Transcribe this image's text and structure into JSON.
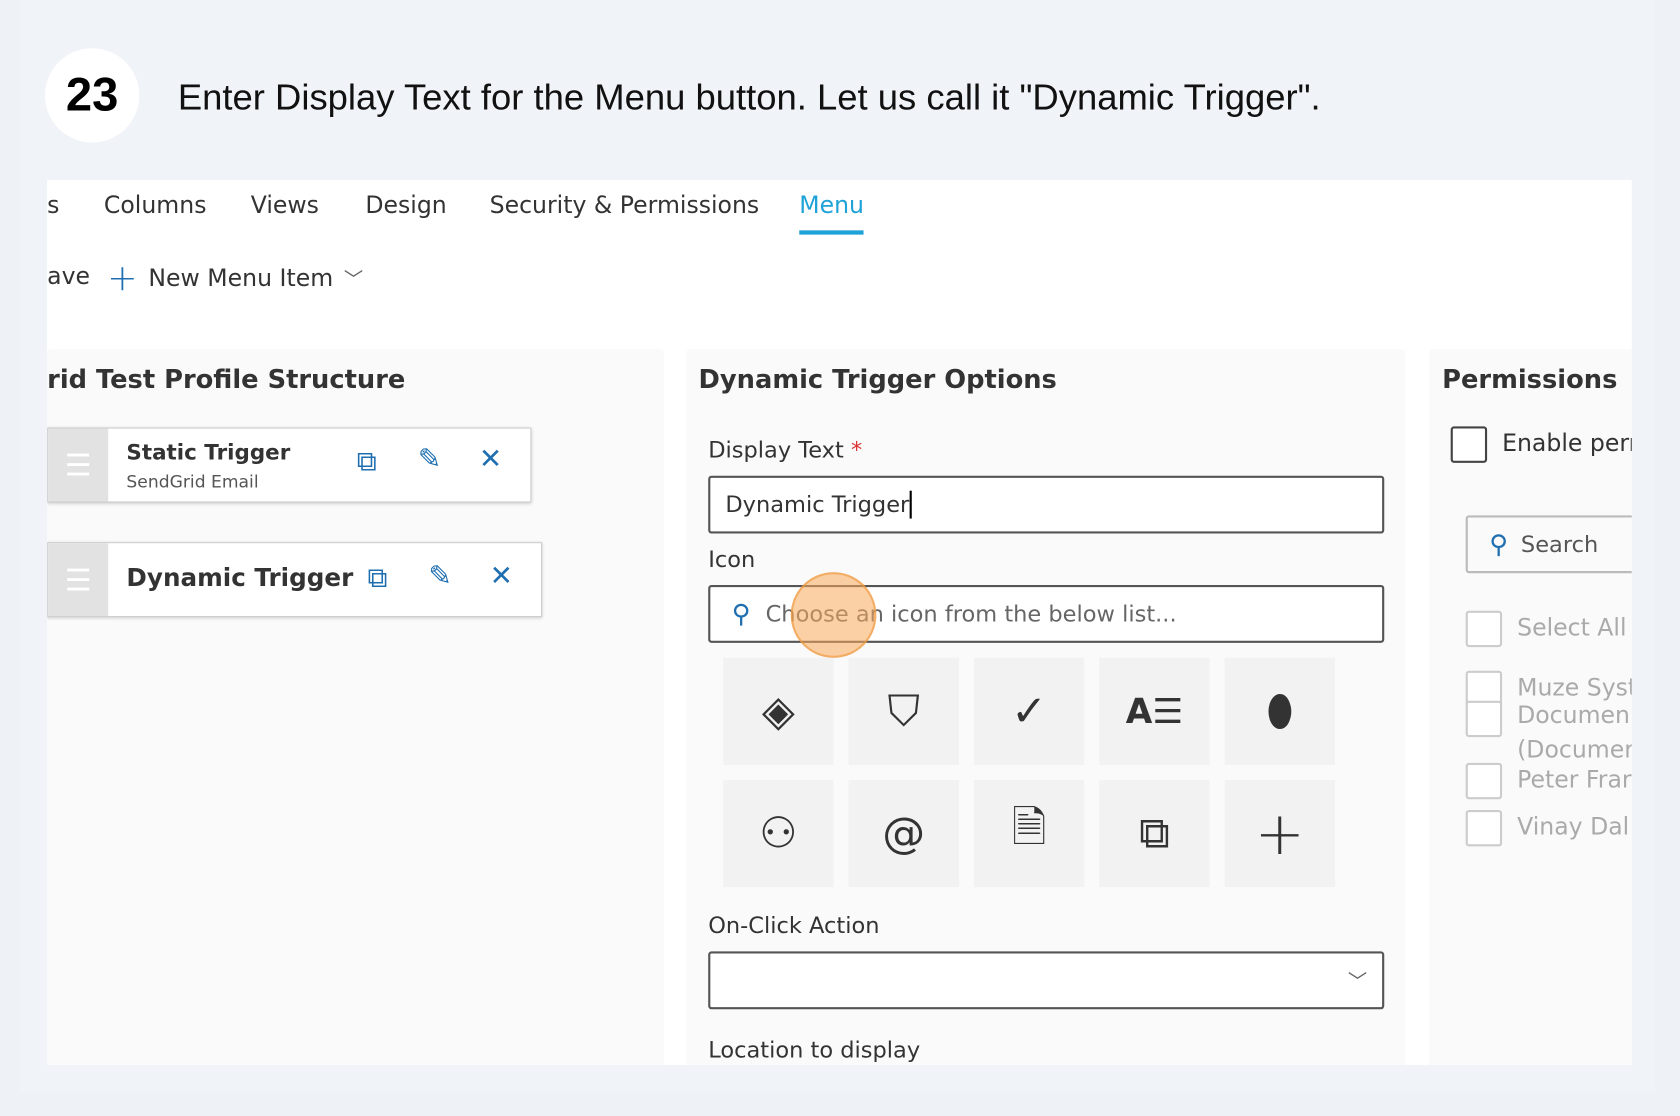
{
  "step": {
    "number": "23",
    "instruction": "Enter Display Text for the Menu button. Let us call it \"Dynamic Trigger\"."
  },
  "tabs": [
    "s",
    "Columns",
    "Views",
    "Design",
    "Security & Permissions",
    "Menu"
  ],
  "active_tab": "Menu",
  "toolbar": {
    "save_partial": "ave",
    "new_menu_item": "New Menu Item"
  },
  "structure": {
    "title": "rid Test Profile Structure",
    "items": [
      {
        "title": "Static Trigger",
        "subtitle": "SendGrid Email"
      },
      {
        "title": "Dynamic Trigger"
      }
    ]
  },
  "options": {
    "title": "Dynamic Trigger Options",
    "display_text_label": "Display Text",
    "required_mark": "*",
    "display_text_value": "Dynamic Trigger",
    "icon_label": "Icon",
    "icon_placeholder": "Choose an icon from the below list...",
    "icons": [
      "azure-devops-icon",
      "shield-lightning-icon",
      "checkmark-icon",
      "access-database-icon",
      "database-icon",
      "user-briefcase-icon",
      "at-sign-icon",
      "document-check-icon",
      "chat-bubbles-icon",
      "plus-icon"
    ],
    "on_click_label": "On-Click Action",
    "on_click_value": "",
    "location_label": "Location to display"
  },
  "permissions": {
    "title": "Permissions",
    "enable": "Enable perr",
    "search_placeholder": "Search",
    "select_all": "Select All",
    "users": [
      "Muze Syst",
      "Documen",
      "(Documer",
      "Peter Frar",
      "Vinay Dal"
    ]
  },
  "colors": {
    "accent": "#1ea2d8",
    "icon_blue": "#1f6fb0",
    "cursor": "#f8aa5a"
  }
}
